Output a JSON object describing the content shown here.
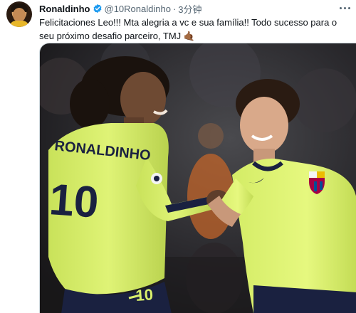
{
  "tweet": {
    "author_name": "Ronaldinho",
    "handle": "@10Ronaldinho",
    "separator": "·",
    "time": "3分钟",
    "text": "Felicitaciones Leo!!! Mta alegria a vc e sua família!! Todo sucesso para o seu próximo desafio parceiro, TMJ 🤙🏾",
    "photo": {
      "left_shirt_name": "RONALDINHO",
      "left_shirt_number": "10",
      "left_shorts_number": "10"
    }
  },
  "colors": {
    "verified_blue": "#1d9bf0",
    "secondary_text": "#536471",
    "kit_lime": "#d9f06b",
    "kit_navy": "#1a2140"
  },
  "icons": {
    "verified": "verified-badge-icon",
    "more": "more-dots-icon"
  }
}
